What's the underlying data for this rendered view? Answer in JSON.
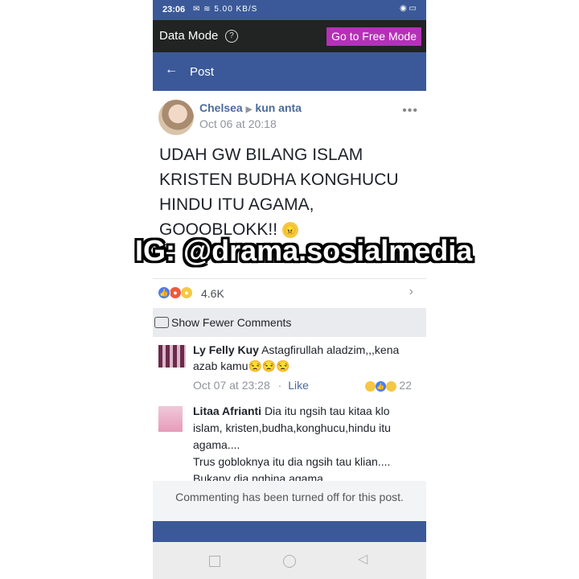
{
  "status_bar": {
    "time": "23:06",
    "left_icons": "✉ ≋ 5.00 KB/S",
    "right_icons": "◉ ▭"
  },
  "data_bar": {
    "mode_label": "Data Mode",
    "help_glyph": "?",
    "free_mode_button": "Go to Free Mode"
  },
  "nav": {
    "back_glyph": "←",
    "title": "Post"
  },
  "post": {
    "author": "Chelsea",
    "target": "kun anta",
    "date": "Oct 06 at 20:18",
    "more_glyph": "•••",
    "text": "UDAH GW BILANG ISLAM KRISTEN BUDHA KONGHUCU HINDU ITU AGAMA, GOOOBLOKK!!",
    "emoji": "😠",
    "reaction_count": "4.6K"
  },
  "watermark": "IG: @drama.sosialmedia",
  "show_fewer": "Show Fewer Comments",
  "comments": [
    {
      "name": "Ly Felly Kuy",
      "text": "Astagfirullah aladzim,,,kena azab kamu😒😒😒",
      "date": "Oct 07 at 23:28",
      "like": "Like",
      "reaction_count": "22"
    },
    {
      "name": "Litaa Afrianti",
      "text": "Dia itu ngsih tau kitaa klo islam, kristen,budha,konghucu,hindu itu agama....",
      "text2": "Trus gobloknya itu dia ngsih tau klian....",
      "text3": "Bukany dia nghina agama....."
    }
  ],
  "footer_text": "Commenting has been turned off for this post.",
  "colors": {
    "facebook_blue": "#3b5998",
    "free_mode": "#b531b6",
    "data_bar": "#222323"
  }
}
